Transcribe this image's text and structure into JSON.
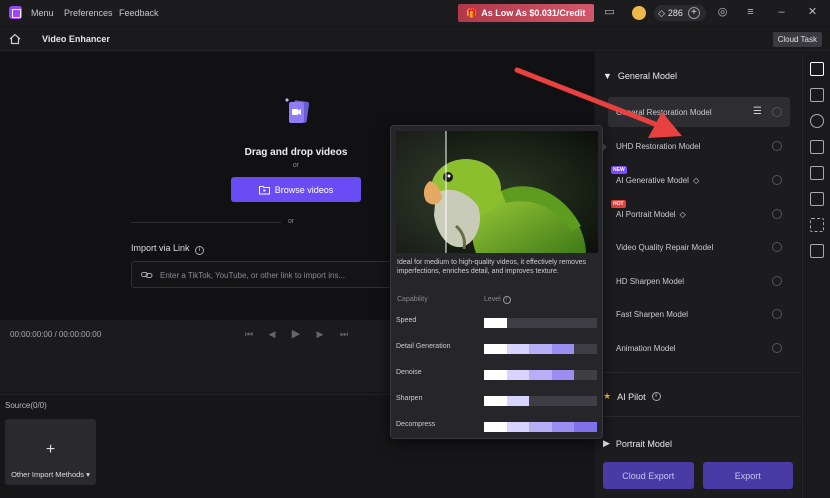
{
  "topbar": {
    "menu": [
      "Menu",
      "Preferences",
      "Feedback"
    ],
    "promo": "As Low As $0.031/Credit",
    "credits": "286"
  },
  "subbar": {
    "title": "Video Enhancer",
    "cloud_task": "Cloud Task"
  },
  "drop": {
    "title": "Drag and drop videos",
    "or1": "or",
    "browse": "Browse videos",
    "or2": "or",
    "import_label": "Import via Link",
    "link_placeholder": "Enter a TikTok, YouTube, or other link to import ins..."
  },
  "playback": {
    "timecode": "00:00:00:00 / 00:00:00:00"
  },
  "source": {
    "label": "Source(0/0)",
    "import_tile": "Other Import Methods"
  },
  "panel": {
    "general_model": "General Model",
    "models": [
      {
        "label": "General Restoration Model",
        "tag": ""
      },
      {
        "label": "UHD Restoration Model",
        "tag": ""
      },
      {
        "label": "AI Generative Model",
        "tag": "NEW"
      },
      {
        "label": "AI Portrait Model",
        "tag": "HOT"
      },
      {
        "label": "Video Quality Repair Model",
        "tag": ""
      },
      {
        "label": "HD Sharpen Model",
        "tag": ""
      },
      {
        "label": "Fast Sharpen Model",
        "tag": ""
      },
      {
        "label": "Animation Model",
        "tag": ""
      }
    ],
    "ai_pilot": "AI Pilot",
    "portrait_model": "Portrait Model",
    "cloud_export": "Cloud Export",
    "export": "Export"
  },
  "popup": {
    "description": "Ideal for medium to high-quality videos, it effectively removes imperfections, enriches detail, and improves texture.",
    "capability_head": "Capability",
    "level_head": "Level",
    "capabilities": [
      {
        "name": "Speed",
        "level": 0.2
      },
      {
        "name": "Detail Generation",
        "level": 0.8
      },
      {
        "name": "Denoise",
        "level": 0.8
      },
      {
        "name": "Sharpen",
        "level": 0.4
      },
      {
        "name": "Decompress",
        "level": 1.0
      }
    ]
  },
  "colors": {
    "accent": "#6a4cf5",
    "annotation": "#e8413f"
  }
}
